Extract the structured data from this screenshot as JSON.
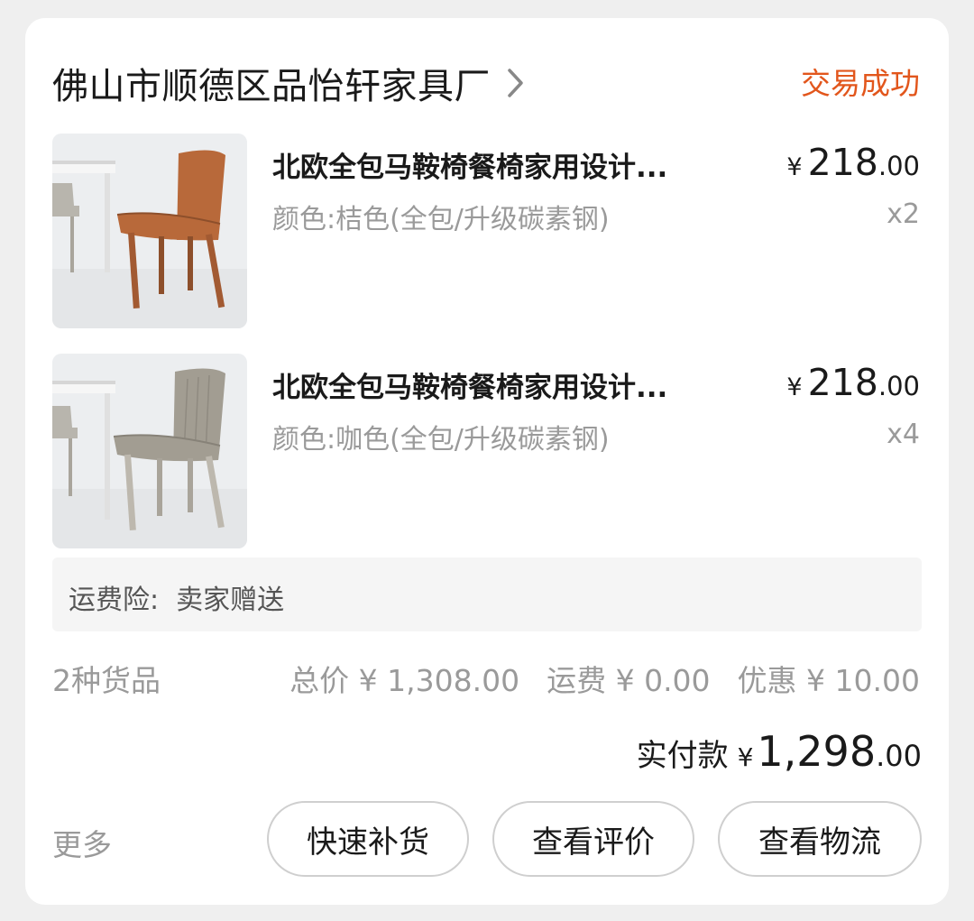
{
  "shop": {
    "name": "佛山市顺德区品怡轩家具厂",
    "status": "交易成功"
  },
  "items": [
    {
      "title": "北欧全包马鞍椅餐椅家用设计...",
      "spec": "颜色:桔色(全包/升级碳素钢)",
      "price_symbol": "¥",
      "price_int": "218",
      "price_dec": ".00",
      "quantity": "x2",
      "image": "orange-leather-dining-chair",
      "chair_color": "#b8693a"
    },
    {
      "title": "北欧全包马鞍椅餐椅家用设计...",
      "spec": "颜色:咖色(全包/升级碳素钢)",
      "price_symbol": "¥",
      "price_int": "218",
      "price_dec": ".00",
      "quantity": "x4",
      "image": "taupe-leather-dining-chair",
      "chair_color": "#a29d92"
    }
  ],
  "freight_insurance": "运费险:  卖家赠送",
  "summary": {
    "kinds": "2种货品",
    "total": "总价 ¥ 1,308.00",
    "shipping": "运费 ¥ 0.00",
    "discount": "优惠 ¥ 10.00"
  },
  "paid": {
    "label": "实付款",
    "symbol": "¥",
    "int": "1,298",
    "dec": ".00"
  },
  "actions": {
    "more": "更多",
    "restock": "快速补货",
    "review": "查看评价",
    "logistics": "查看物流"
  },
  "colors": {
    "status": "#e2561c",
    "text": "#1a1a1a",
    "muted": "#9a9a9a",
    "background": "#efefef"
  }
}
